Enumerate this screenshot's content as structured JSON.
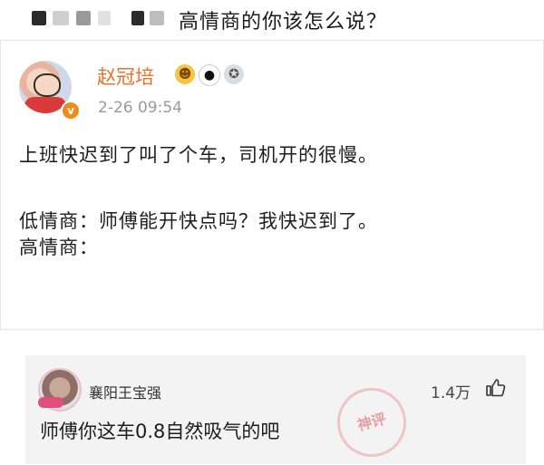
{
  "header": {
    "title": "高情商的你该怎么说？"
  },
  "post": {
    "username": "赵冠培",
    "verified_icon": "v",
    "user_icons": [
      "crown-emoji-icon",
      "panda-icon",
      "medal-icon"
    ],
    "time": "2-26 09:54",
    "lines": [
      "上班快迟到了叫了个车，司机开的很慢。",
      "低情商：师傅能开快点吗？我快迟到了。",
      "高情商："
    ]
  },
  "comment": {
    "username": "襄阳王宝强",
    "likes": "1.4万",
    "text": "师傅你这车0.8自然吸气的吧",
    "stamp": "神评"
  },
  "colors": {
    "username": "#e8722e",
    "time": "#9a9a9a",
    "comment_bg": "#f3f3f3"
  }
}
